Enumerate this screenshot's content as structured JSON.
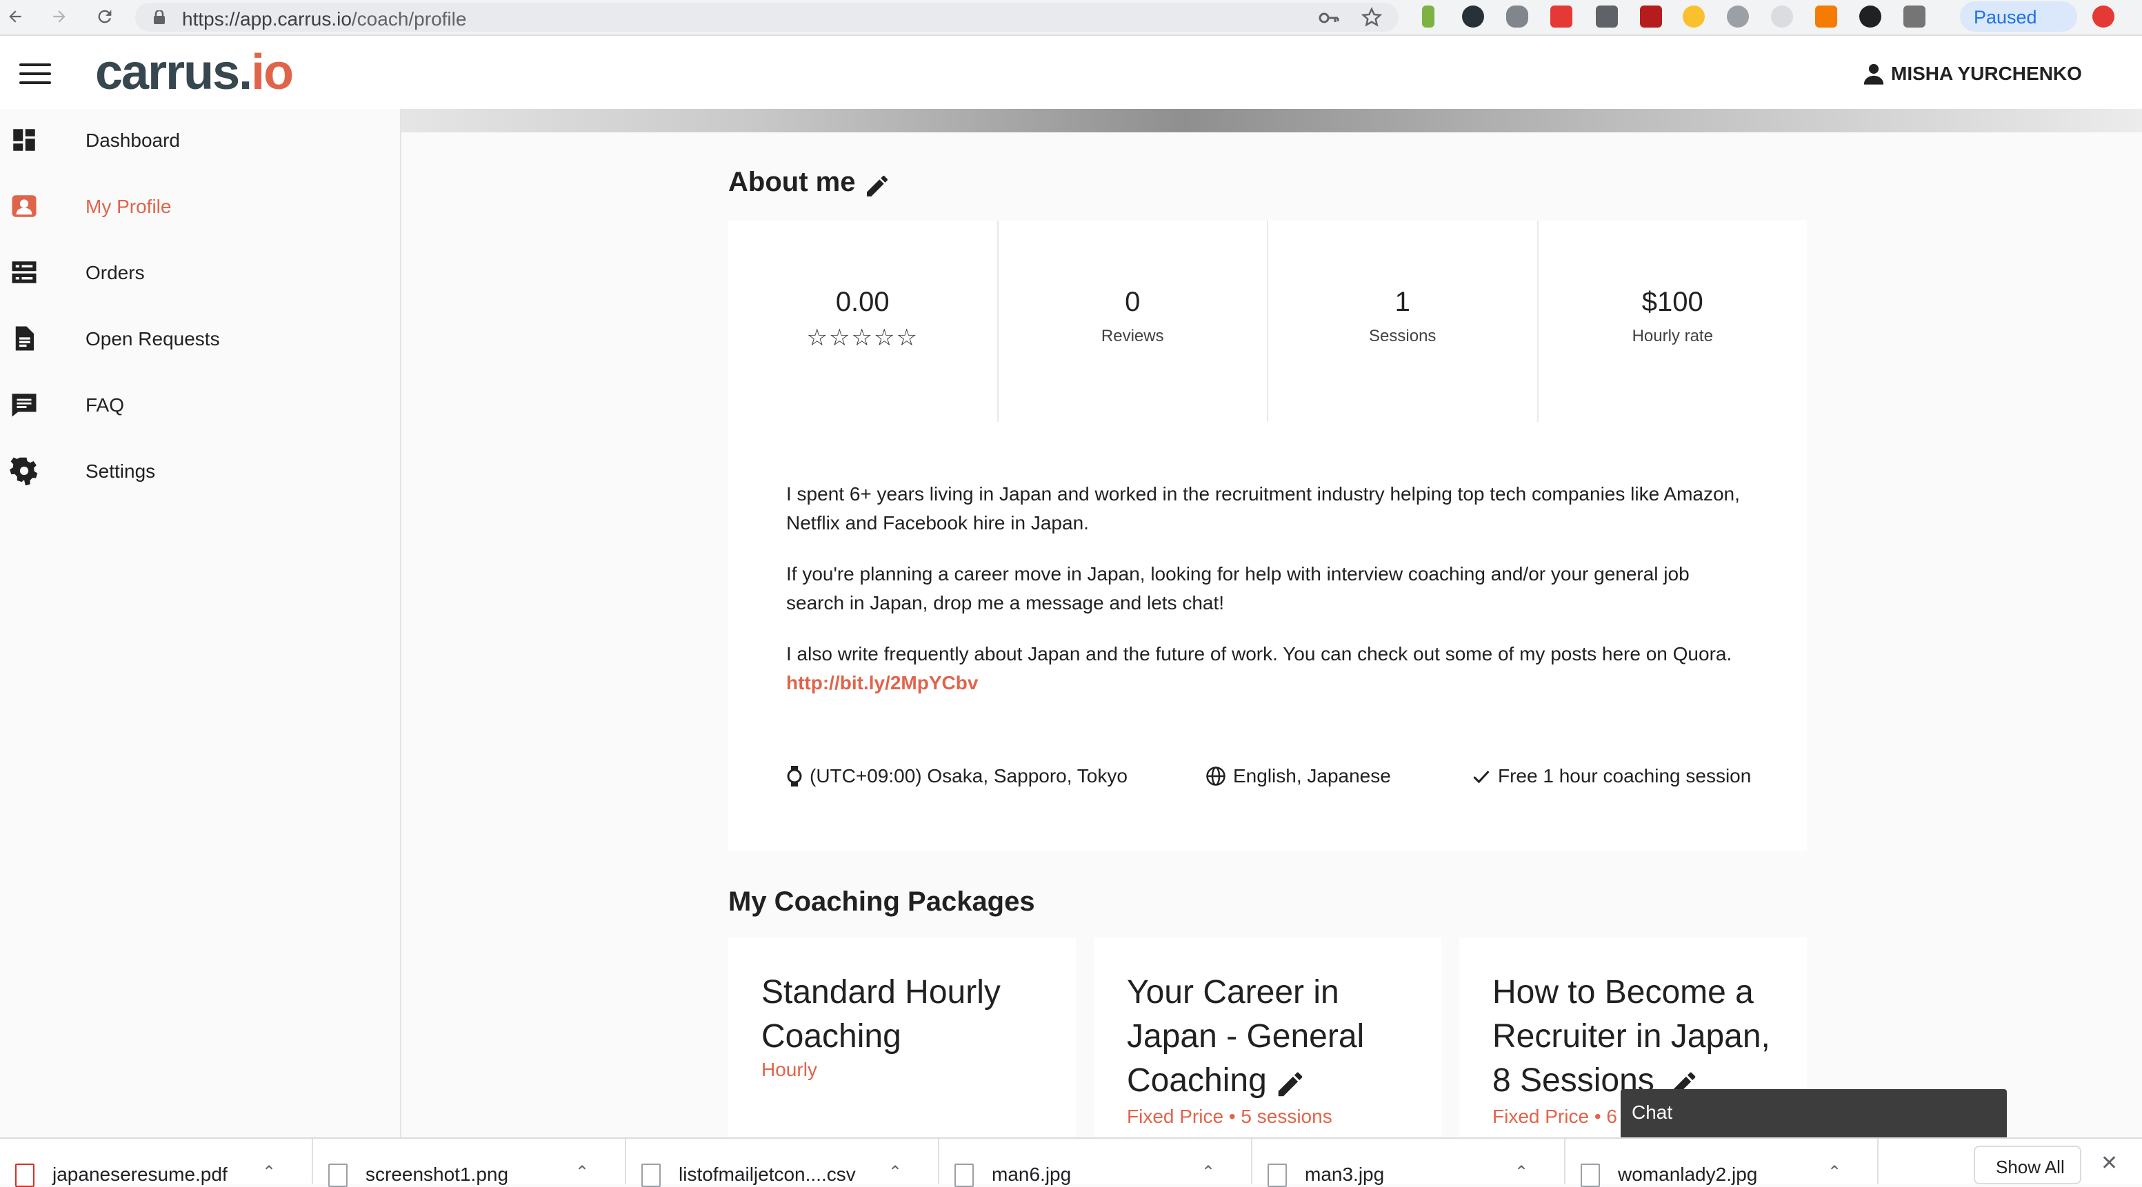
{
  "browser": {
    "url_host": "https://app.carrus.io",
    "url_path": "/coach/profile",
    "profile_status": "Paused"
  },
  "header": {
    "logo_main": "carrus.",
    "logo_accent": "io",
    "user_name": "MISHA YURCHENKO"
  },
  "sidebar": {
    "items": [
      {
        "label": "Dashboard",
        "icon": "dashboard-icon"
      },
      {
        "label": "My Profile",
        "icon": "profile-icon",
        "active": true
      },
      {
        "label": "Orders",
        "icon": "orders-icon"
      },
      {
        "label": "Open Requests",
        "icon": "document-icon"
      },
      {
        "label": "FAQ",
        "icon": "comment-icon"
      },
      {
        "label": "Settings",
        "icon": "gear-icon"
      }
    ]
  },
  "about": {
    "title": "About me",
    "stats": [
      {
        "value": "0.00",
        "caption": "",
        "stars": "☆☆☆☆☆",
        "rating": 0
      },
      {
        "value": "0",
        "caption": "Reviews"
      },
      {
        "value": "1",
        "caption": "Sessions"
      },
      {
        "value": "$100",
        "caption": "Hourly rate"
      }
    ],
    "bio": [
      "I spent 6+ years living in Japan and worked in the recruitment industry helping top tech companies like Amazon, Netflix and Facebook hire in Japan.",
      "If you're planning a career move in Japan, looking for help with interview coaching and/or your general job search in Japan, drop me a message and lets chat!",
      "I also write frequently about Japan and the future of work. You can check out some of my posts here on Quora."
    ],
    "link": "http://bit.ly/2MpYCbv",
    "timezone": "(UTC+09:00) Osaka, Sapporo, Tokyo",
    "languages": "English, Japanese",
    "free_session": "Free 1 hour coaching session"
  },
  "packages": {
    "title": "My Coaching Packages",
    "items": [
      {
        "title": "Standard Hourly Coaching",
        "subtitle": "Hourly"
      },
      {
        "title": "Your Career in Japan - General Coaching",
        "subtitle": "Fixed Price • 5 sessions"
      },
      {
        "title": "How to Become a Recruiter in Japan, 8 Sessions",
        "subtitle": "Fixed Price • 6"
      }
    ]
  },
  "chat": {
    "label": "Chat"
  },
  "downloads": {
    "files": [
      "japaneseresume.pdf",
      "screenshot1.png",
      "listofmailjetcon....csv",
      "man6.jpg",
      "man3.jpg",
      "womanlady2.jpg"
    ],
    "show_all": "Show All"
  },
  "colors": {
    "accent": "#e0644a",
    "chat_bg": "#3d3d3d"
  }
}
